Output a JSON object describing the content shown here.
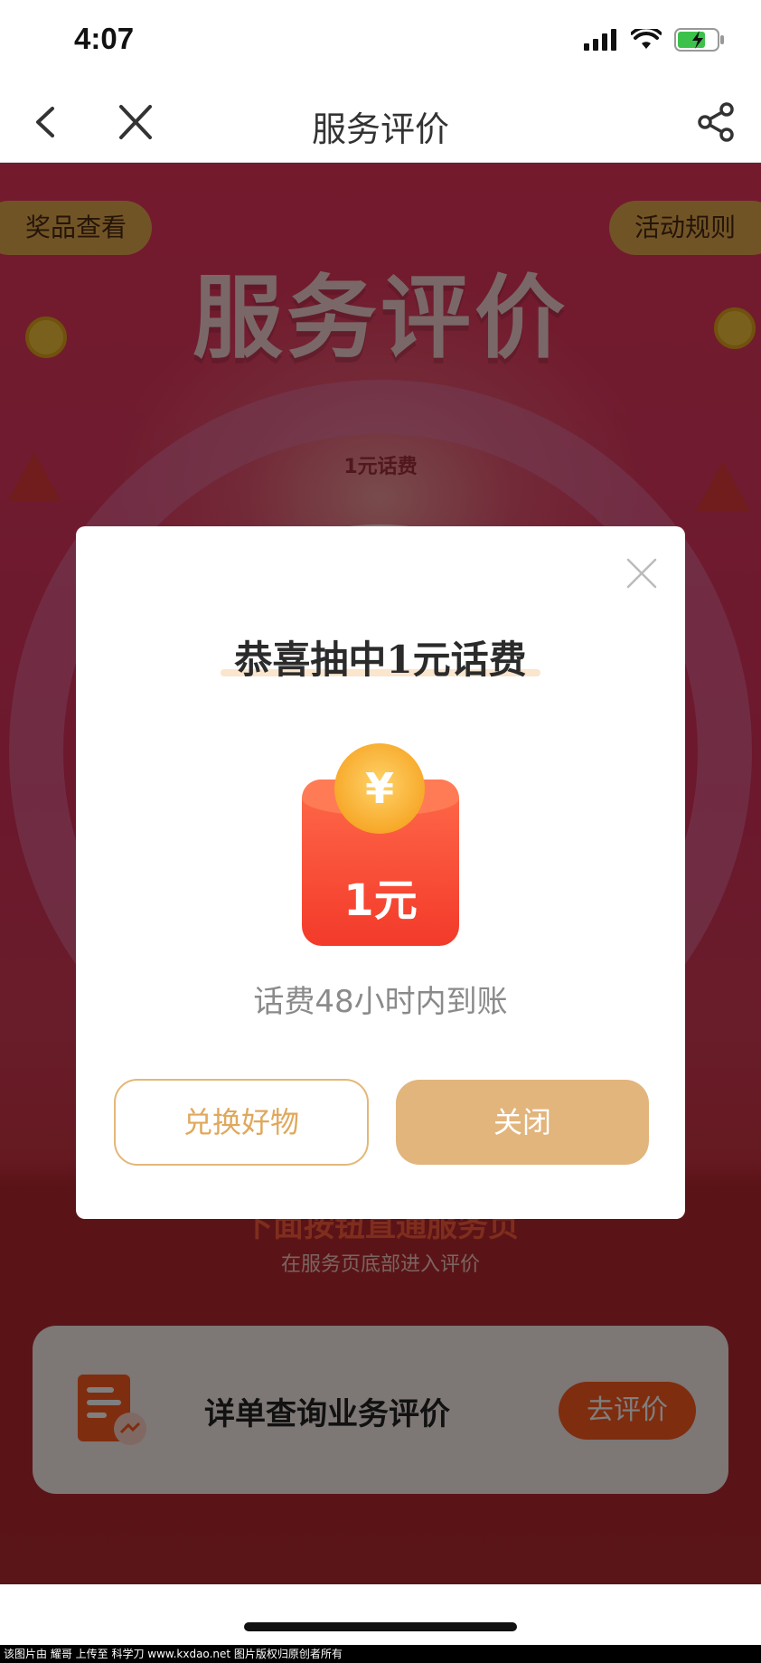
{
  "status_bar": {
    "time": "4:07"
  },
  "nav": {
    "title": "服务评价"
  },
  "campaign": {
    "prize_view": "奖品查看",
    "rules": "活动规则",
    "title": "服务评价",
    "wheel_prize": "1元话费",
    "section_heading": "下面按钮直通服务页",
    "section_sub": "在服务页底部进入评价",
    "eval_label": "详单查询业务评价",
    "eval_button": "去评价"
  },
  "modal": {
    "title": "恭喜抽中1元话费",
    "coin_symbol": "¥",
    "amount": "1元",
    "note": "话费48小时内到账",
    "exchange_button": "兑换好物",
    "close_button": "关闭"
  },
  "footer": {
    "watermark": "该图片由 耀哥 上传至 科学刀 www.kxdao.net 图片版权归原创者所有"
  },
  "colors": {
    "accent": "#e2b57d",
    "campaign_red": "#e0375f",
    "envelope_red": "#f33a2a"
  }
}
